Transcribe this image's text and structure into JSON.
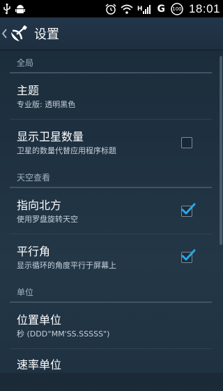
{
  "status_bar": {
    "time": "18:01",
    "battery": "100",
    "network_label": "G",
    "signal_badge": "H"
  },
  "action_bar": {
    "title": "设置"
  },
  "sections": [
    {
      "header": "全局",
      "items": [
        {
          "title": "主题",
          "summary": "专业版: 透明黑色",
          "checkbox": null
        },
        {
          "title": "显示卫星数量",
          "summary": "卫星的数量代替应用程序标题",
          "checkbox": false
        }
      ]
    },
    {
      "header": "天空查看",
      "items": [
        {
          "title": "指向北方",
          "summary": "使用罗盘旋转天空",
          "checkbox": true
        },
        {
          "title": "平行角",
          "summary": "显示循环的角度平行于屏幕上",
          "checkbox": true
        }
      ]
    },
    {
      "header": "单位",
      "items": [
        {
          "title": "位置单位",
          "summary": "秒 (DDD°MM'SS.SSSSS\")",
          "checkbox": null
        },
        {
          "title": "速率单位",
          "summary": "",
          "checkbox": null
        }
      ]
    }
  ],
  "colors": {
    "background": "#1e3040",
    "accent_check": "#2aa8e6",
    "section_text": "#9fb2c0"
  }
}
